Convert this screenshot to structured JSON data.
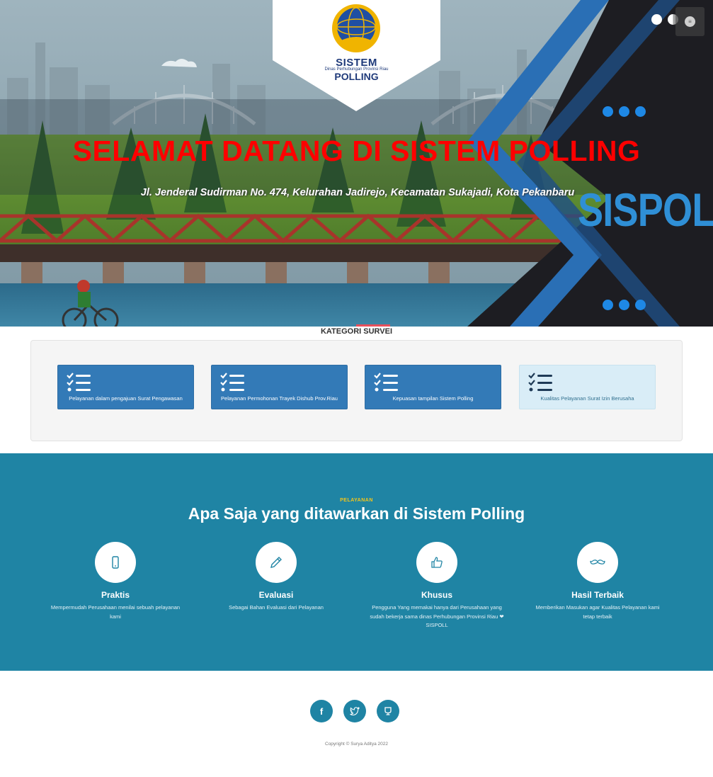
{
  "hero": {
    "logo_line1": "SISTEM",
    "logo_line2": "Dinas Perhubungan Provinsi Riau",
    "logo_line3": "POLLING",
    "title": "SELAMAT DATANG DI SISTEM POLLING",
    "address": "Jl. Jenderal Sudirman No. 474, Kelurahan Jadirejo, Kecamatan Sukajadi, Kota Pekanbaru",
    "brand": "SISPOL"
  },
  "kategori": {
    "title": "KATEGORI SURVEI",
    "cards": [
      {
        "label": "Pelayanan dalam pengajuan Surat Pengawasan"
      },
      {
        "label": "Pelayanan Permohonan Trayek Dishub Prov.Riau"
      },
      {
        "label": "Kepuasan tampilan Sistem Polling"
      },
      {
        "label": "Kualitas Pelayanan Surat Izin Berusaha"
      }
    ]
  },
  "services": {
    "eyebrow": "PELAYANAN",
    "title": "Apa Saja yang ditawarkan di Sistem Polling",
    "items": [
      {
        "icon": "phone-icon",
        "name": "Praktis",
        "desc": "Mempermudah Perusahaan menilai sebuah pelayanan kami"
      },
      {
        "icon": "pencil-icon",
        "name": "Evaluasi",
        "desc": "Sebagai Bahan Evaluasi dari Pelayanan"
      },
      {
        "icon": "thumbs-up-icon",
        "name": "Khusus",
        "desc": "Pengguna Yang memakai hanya dari Perusahaan yang sudah bekerja sama dinas Perhubungan Provinsi Riau ❤ SISPOLL"
      },
      {
        "icon": "mustache-icon",
        "name": "Hasil Terbaik",
        "desc": "Memberikan Masukan agar Kualitas Pelayanan kami tetap terbaik"
      }
    ]
  },
  "footer": {
    "social": [
      "facebook-icon",
      "twitter-icon",
      "dribbble-icon"
    ],
    "copyright": "Copyright © Surya Aditya 2022"
  },
  "colors": {
    "primary": "#337ab7",
    "teal": "#1f84a4",
    "title_red": "#ff0000",
    "brand_blue": "#2f8fd6"
  }
}
